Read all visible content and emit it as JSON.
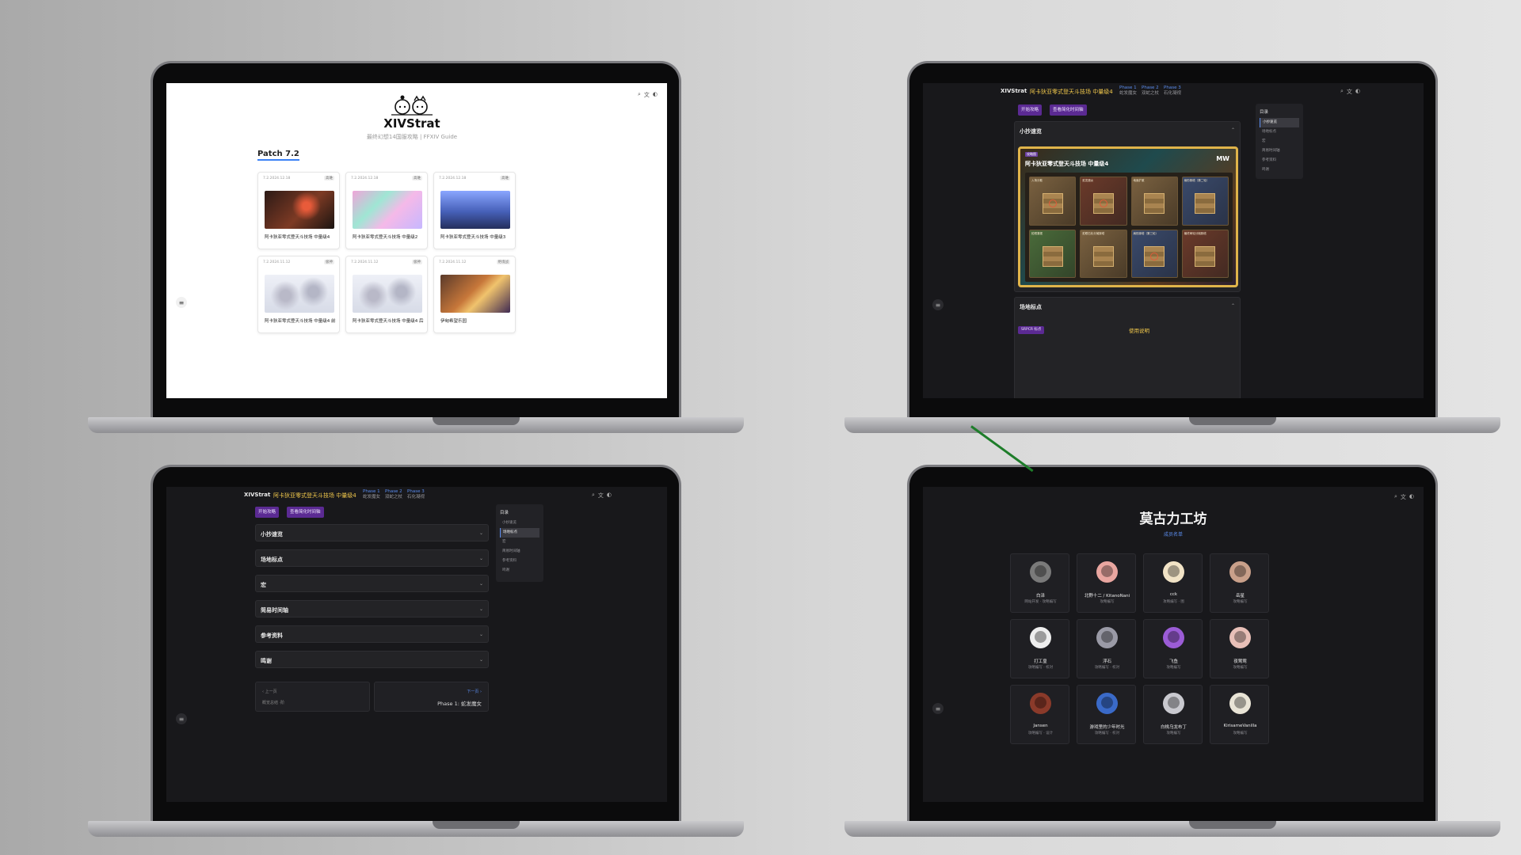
{
  "screen1": {
    "logo_text": "XIVStrat",
    "subtitle": "最终幻想14国服攻略 | FFXIV Guide",
    "section_title": "Patch 7.2",
    "toolbar_icons": [
      "search-icon",
      "language-icon",
      "theme-icon"
    ],
    "side_toggle": "≡",
    "cards": [
      {
        "date": "7.2.2024.12.18",
        "badge": "高难",
        "title": "阿卡狄亚零式登天斗技场 中量级4"
      },
      {
        "date": "7.2.2024.12.18",
        "badge": "高难",
        "title": "阿卡狄亚零式登天斗技场 中量级2"
      },
      {
        "date": "7.2.2024.12.18",
        "badge": "高难",
        "title": "阿卡狄亚零式登天斗技场 中量级3"
      },
      {
        "date": "7.2.2024.11.12",
        "badge": "极神",
        "title": "阿卡狄亚零式登天斗技场 中量级4 前半"
      },
      {
        "date": "7.2.2024.11.12",
        "badge": "极神",
        "title": "阿卡狄亚零式登天斗技场 中量级4 后半"
      },
      {
        "date": "7.2.2024.11.12",
        "badge": "绝境战",
        "title": "伊甸希望乐园"
      }
    ]
  },
  "screen2": {
    "logo_text": "XIVStrat",
    "page_title": "阿卡狄亚零式登天斗技场 中量级4",
    "phases": [
      {
        "name": "Phase 1",
        "sub": "蛇发魔女"
      },
      {
        "name": "Phase 2",
        "sub": "双蛇之杖"
      },
      {
        "name": "Phase 3",
        "sub": "石化凝视"
      }
    ],
    "buttons": [
      "开始攻略",
      "查看简化时间轴"
    ],
    "accordion_top": "小抄速览",
    "strat_tag": "攻略图",
    "strat_title": "阿卡狄亚零式登天斗技场 中量级4",
    "strat_logo": "MW",
    "panels": [
      "入场分散",
      "蛇发魔女",
      "地面扩散",
      "扇形踩塔（第二轮）",
      "蛇眼凝视",
      "蛇眼石化分摊踩塔",
      "扇形踩塔（第三轮）",
      "最终两轮分摊踩塔"
    ],
    "accordion_bottom": "场地标点",
    "sub_btn": "SRPCR 标点",
    "yellow_link": "使用说明",
    "toc_title": "目录",
    "toc_items": [
      "小抄速览",
      "场地标点",
      "宏",
      "简易时间轴",
      "参考资料",
      "鸣谢"
    ]
  },
  "screen3": {
    "logo_text": "XIVStrat",
    "page_title": "阿卡狄亚零式登天斗技场 中量级4",
    "phases": [
      {
        "name": "Phase 1",
        "sub": "蛇发魔女"
      },
      {
        "name": "Phase 2",
        "sub": "双蛇之杖"
      },
      {
        "name": "Phase 3",
        "sub": "石化凝视"
      }
    ],
    "buttons": [
      "开始攻略",
      "查看简化时间轴"
    ],
    "sections": [
      "小抄速览",
      "场地标点",
      "宏",
      "简易时间轴",
      "参考资料",
      "鸣谢"
    ],
    "pager_prev_label": "‹ 上一页",
    "pager_prev_title": "概览总结 ·阶",
    "pager_next_label": "下一页 ›",
    "pager_next_title": "Phase 1: 蛇发魔女",
    "toc_title": "目录",
    "toc_items": [
      "小抄速览",
      "场地标点",
      "宏",
      "简易时间轴",
      "参考资料",
      "鸣谢"
    ]
  },
  "screen4": {
    "title": "莫古力工坊",
    "subtitle": "成员名单",
    "people": [
      {
        "name": "白泽",
        "role": "网站开发 · 攻略编写",
        "color": "#7a7a7a"
      },
      {
        "name": "北野十二 / KitanoNani",
        "role": "攻略编写",
        "color": "#e9a6a0"
      },
      {
        "name": "cck",
        "role": "攻略编写 · 图",
        "color": "#f1e3c6"
      },
      {
        "name": "岳星",
        "role": "攻略编写",
        "color": "#c9a08a"
      },
      {
        "name": "打工皇",
        "role": "攻略编写 · 校对",
        "color": "#eeeeee"
      },
      {
        "name": "浮石",
        "role": "攻略编写 · 校对",
        "color": "#9a9aa6"
      },
      {
        "name": "飞鱼",
        "role": "攻略编写",
        "color": "#9b5cd6"
      },
      {
        "name": "夜莺莺",
        "role": "攻略编写",
        "color": "#e8c0b8"
      },
      {
        "name": "Jansen",
        "role": "攻略编写 · 设计",
        "color": "#8a3a2a"
      },
      {
        "name": "游戏里的少年时光",
        "role": "攻略编写 · 校对",
        "color": "#3a6ac8"
      },
      {
        "name": "白桃乌龙布丁",
        "role": "攻略编写",
        "color": "#c9c9cf"
      },
      {
        "name": "KirisameVanilla",
        "role": "攻略编写",
        "color": "#e9e4d6"
      }
    ]
  }
}
